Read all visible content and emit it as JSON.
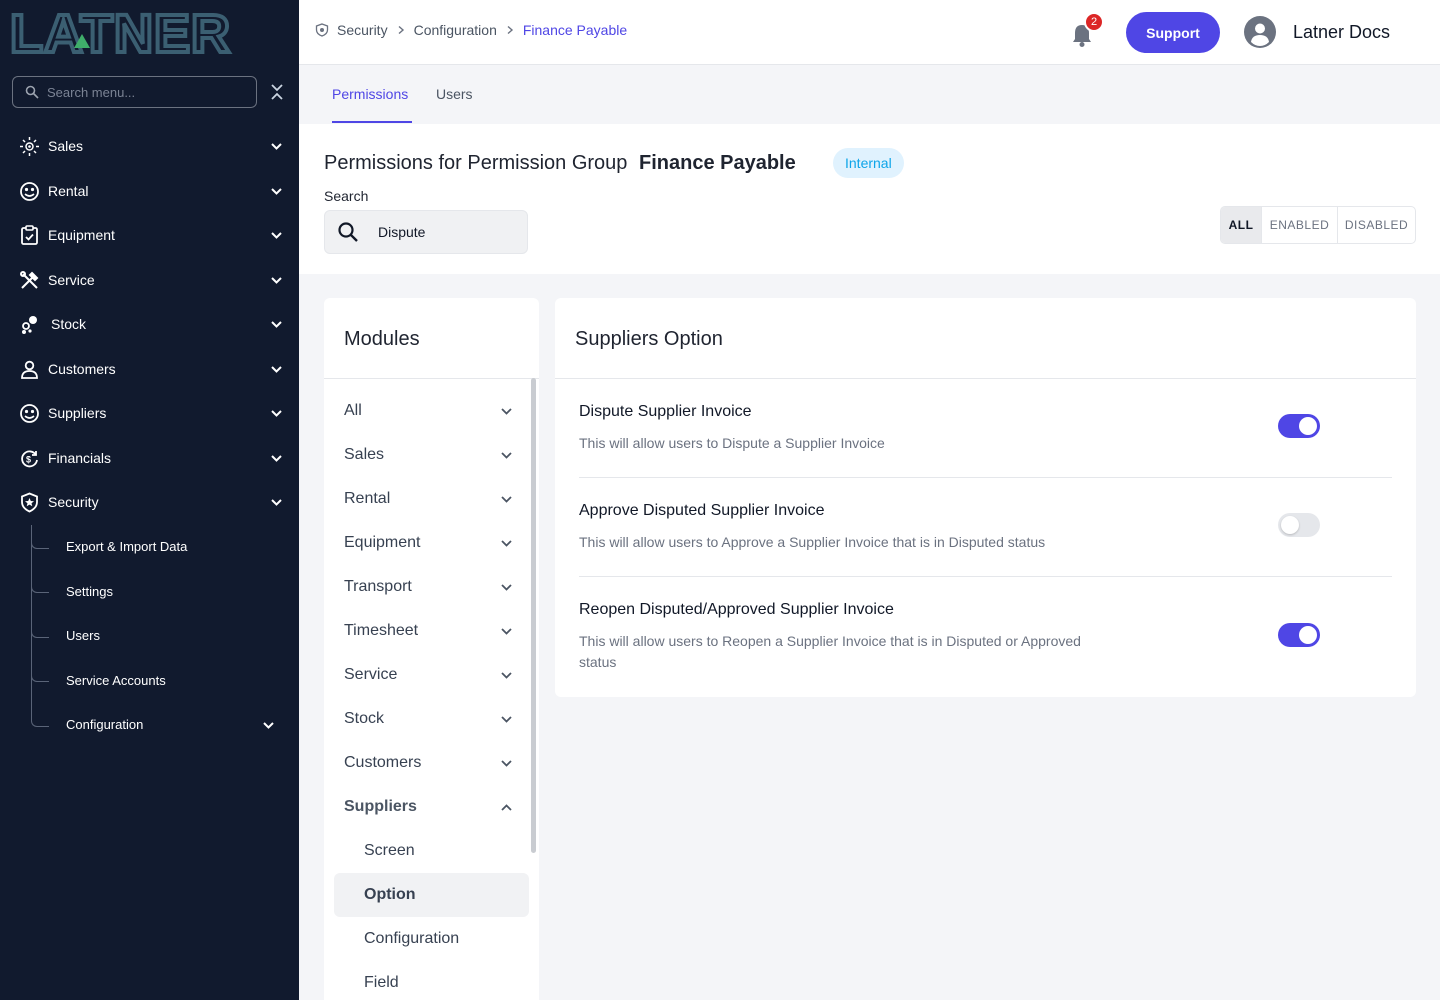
{
  "logo": {
    "text": "LATNER"
  },
  "sidebar": {
    "search_placeholder": "Search menu...",
    "items": [
      {
        "label": "Sales"
      },
      {
        "label": "Rental"
      },
      {
        "label": "Equipment"
      },
      {
        "label": "Service"
      },
      {
        "label": "Stock"
      },
      {
        "label": "Customers"
      },
      {
        "label": "Suppliers"
      },
      {
        "label": "Financials"
      },
      {
        "label": "Security"
      }
    ],
    "security_sub": [
      {
        "label": "Export & Import Data"
      },
      {
        "label": "Settings"
      },
      {
        "label": "Users"
      },
      {
        "label": "Service Accounts"
      },
      {
        "label": "Configuration"
      }
    ]
  },
  "header": {
    "breadcrumb": [
      "Security",
      "Configuration",
      "Finance Payable"
    ],
    "notification_count": "2",
    "support_label": "Support",
    "user_name": "Latner Docs"
  },
  "tabs": [
    {
      "label": "Permissions"
    },
    {
      "label": "Users"
    }
  ],
  "page": {
    "title_prefix": "Permissions for Permission Group",
    "group_name": "Finance Payable",
    "group_badge": "Internal",
    "search_label": "Search",
    "search_value": "Dispute",
    "filters": [
      "ALL",
      "ENABLED",
      "DISABLED"
    ]
  },
  "modules": {
    "title": "Modules",
    "items": [
      "All",
      "Sales",
      "Rental",
      "Equipment",
      "Transport",
      "Timesheet",
      "Service",
      "Stock",
      "Customers",
      "Suppliers"
    ],
    "suppliers_sub": [
      "Screen",
      "Option",
      "Configuration",
      "Field"
    ]
  },
  "options": {
    "title": "Suppliers Option",
    "rows": [
      {
        "title": "Dispute Supplier Invoice",
        "desc": "This will allow users to Dispute a Supplier Invoice",
        "enabled": true
      },
      {
        "title": "Approve Disputed Supplier Invoice",
        "desc": "This will allow users to Approve a Supplier Invoice that is in Disputed status",
        "enabled": false
      },
      {
        "title": "Reopen Disputed/Approved Supplier Invoice",
        "desc": "This will allow users to Reopen a Supplier Invoice that is in Disputed or Approved status",
        "enabled": true
      }
    ]
  },
  "colors": {
    "accent": "#4f46e5",
    "sidebar_bg": "#111a2e",
    "logo": "#3b5f72",
    "badge": "#dc2626"
  }
}
